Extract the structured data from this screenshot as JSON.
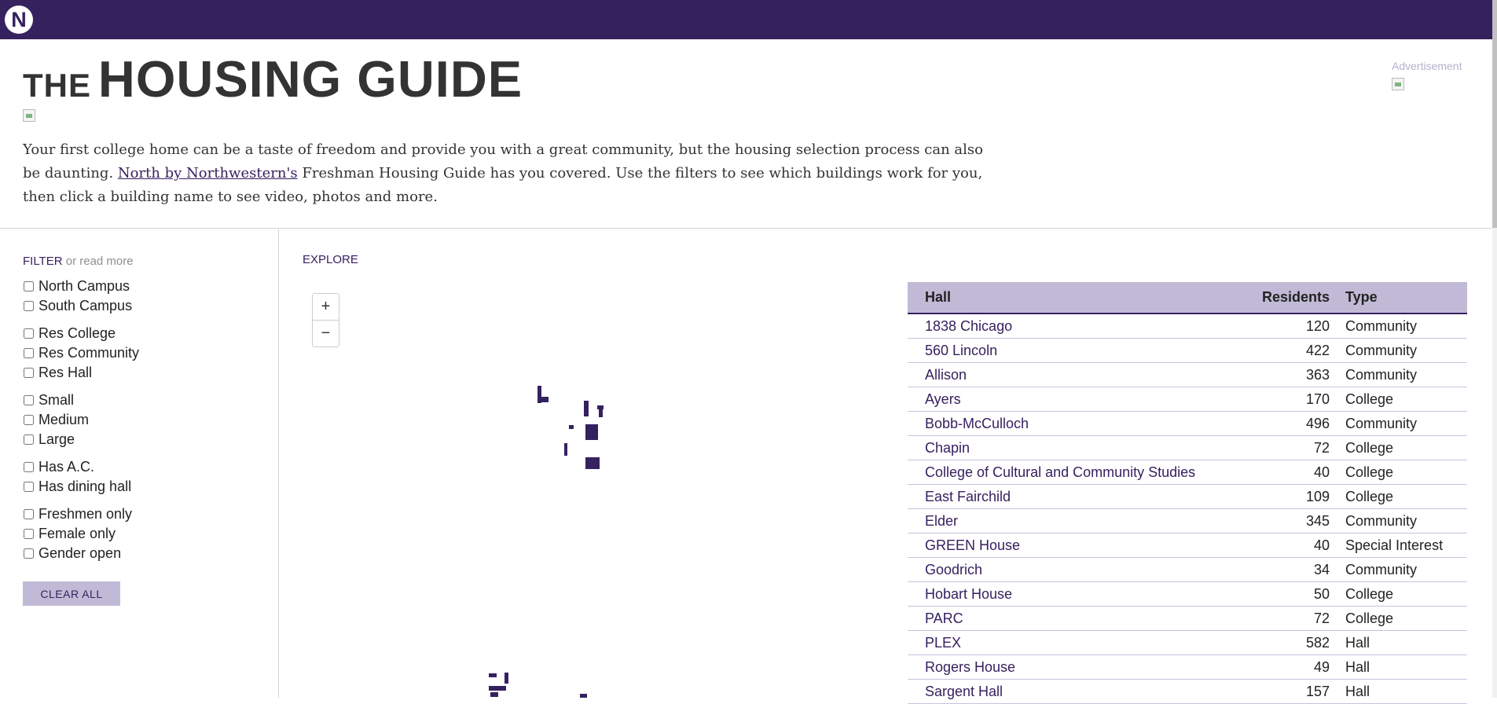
{
  "nav": {
    "logo_letter": "N"
  },
  "header": {
    "title_small": "THE",
    "title_large": "HOUSING GUIDE",
    "intro_before": "Your first college home can be a taste of freedom and provide you with a great community, but the housing selection process can also be daunting. ",
    "intro_link": "North by Northwestern's",
    "intro_after": " Freshman Housing Guide has you covered. Use the filters to see which buildings work for you, then click a building name to see video, photos and more.",
    "ad_label": "Advertisement"
  },
  "filter": {
    "label": "FILTER",
    "read_more": "or read more",
    "groups": [
      [
        "North Campus",
        "South Campus"
      ],
      [
        "Res College",
        "Res Community",
        "Res Hall"
      ],
      [
        "Small",
        "Medium",
        "Large"
      ],
      [
        "Has A.C.",
        "Has dining hall"
      ],
      [
        "Freshmen only",
        "Female only",
        "Gender open"
      ]
    ],
    "clear_label": "CLEAR ALL"
  },
  "explore": {
    "label": "EXPLORE",
    "zoom_in": "+",
    "zoom_out": "−",
    "building_color": "#36215f"
  },
  "table": {
    "headers": {
      "hall": "Hall",
      "residents": "Residents",
      "type": "Type"
    },
    "rows": [
      {
        "hall": "1838 Chicago",
        "residents": "120",
        "type": "Community"
      },
      {
        "hall": "560 Lincoln",
        "residents": "422",
        "type": "Community"
      },
      {
        "hall": "Allison",
        "residents": "363",
        "type": "Community"
      },
      {
        "hall": "Ayers",
        "residents": "170",
        "type": "College"
      },
      {
        "hall": "Bobb-McCulloch",
        "residents": "496",
        "type": "Community"
      },
      {
        "hall": "Chapin",
        "residents": "72",
        "type": "College"
      },
      {
        "hall": "College of Cultural and Community Studies",
        "residents": "40",
        "type": "College"
      },
      {
        "hall": "East Fairchild",
        "residents": "109",
        "type": "College"
      },
      {
        "hall": "Elder",
        "residents": "345",
        "type": "Community"
      },
      {
        "hall": "GREEN House",
        "residents": "40",
        "type": "Special Interest"
      },
      {
        "hall": "Goodrich",
        "residents": "34",
        "type": "Community"
      },
      {
        "hall": "Hobart House",
        "residents": "50",
        "type": "College"
      },
      {
        "hall": "PARC",
        "residents": "72",
        "type": "College"
      },
      {
        "hall": "PLEX",
        "residents": "582",
        "type": "Hall"
      },
      {
        "hall": "Rogers House",
        "residents": "49",
        "type": "Hall"
      },
      {
        "hall": "Sargent Hall",
        "residents": "157",
        "type": "Hall"
      }
    ]
  },
  "colors": {
    "brand_purple": "#36215f",
    "header_row": "#c1bad6",
    "link": "#36215f"
  }
}
